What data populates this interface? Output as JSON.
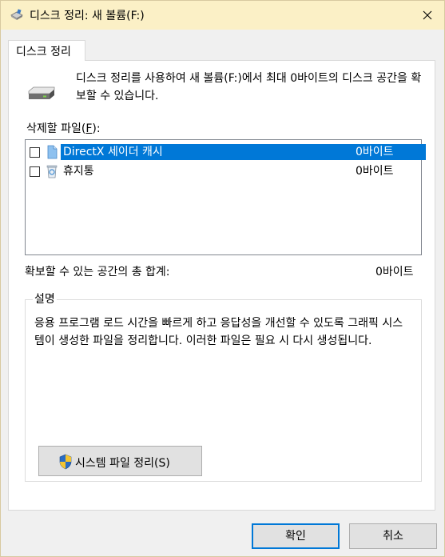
{
  "window": {
    "title": "디스크 정리: 새 볼륨(F:)",
    "title_icon": "disk-cleanup-icon",
    "close_icon": "close-icon"
  },
  "tab": {
    "label": "디스크 정리"
  },
  "intro": {
    "icon": "drive-icon",
    "text": "디스크 정리를 사용하여 새 볼륨(F:)에서 최대 0바이트의 디스크 공간을 확보할 수 있습니다."
  },
  "files": {
    "label_prefix": "삭제할 파일(",
    "label_key": "F",
    "label_suffix": "):",
    "items": [
      {
        "name": "DirectX 세이더 캐시",
        "size": "0바이트",
        "checked": false,
        "selected": true,
        "icon": "file-icon"
      },
      {
        "name": "휴지통",
        "size": "0바이트",
        "checked": false,
        "selected": false,
        "icon": "recycle-bin-icon"
      }
    ]
  },
  "total": {
    "label": "확보할 수 있는 공간의 총 합계:",
    "value": "0바이트"
  },
  "description": {
    "legend": "설명",
    "text": "응용 프로그램 로드 시간을 빠르게 하고 응답성을 개선할 수 있도록 그래픽 시스템이 생성한 파일을 정리합니다. 이러한 파일은 필요 시 다시 생성됩니다."
  },
  "buttons": {
    "system_cleanup": "시스템 파일 정리(S)",
    "system_cleanup_icon": "uac-shield-icon",
    "ok": "확인",
    "cancel": "취소"
  },
  "colors": {
    "titlebar": "#fbf0c6",
    "selection": "#0078d7",
    "default_button_border": "#0078d7"
  }
}
